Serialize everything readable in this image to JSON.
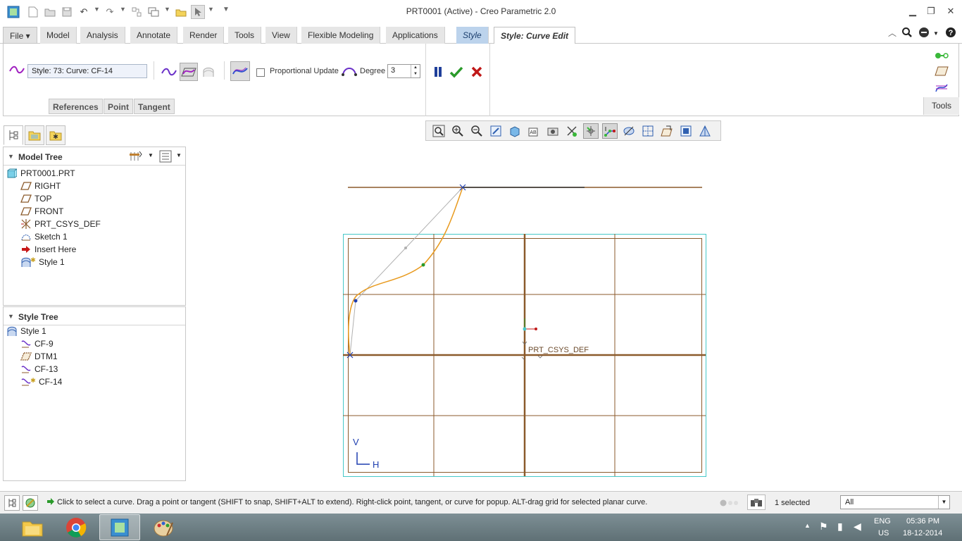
{
  "window": {
    "title": "PRT0001 (Active) - Creo Parametric 2.0"
  },
  "quick_access": {
    "icons": [
      "new-icon",
      "open-icon",
      "save-icon",
      "undo-icon",
      "redo-icon",
      "regenerate-icon",
      "windows-icon",
      "close-icon",
      "select-icon"
    ]
  },
  "tabs": [
    {
      "label": "File"
    },
    {
      "label": "Model"
    },
    {
      "label": "Analysis"
    },
    {
      "label": "Annotate"
    },
    {
      "label": "Render"
    },
    {
      "label": "Tools"
    },
    {
      "label": "View"
    },
    {
      "label": "Flexible Modeling"
    },
    {
      "label": "Applications"
    },
    {
      "label": "Style"
    },
    {
      "label": "Style: Curve Edit"
    }
  ],
  "ribbon": {
    "style_label": "Style: 73: Curve:   CF-14",
    "proportional_update_label": "Proportional Update",
    "proportional_update_checked": false,
    "degree_label": "Degree",
    "degree_value": "3",
    "subtabs": [
      "References",
      "Point",
      "Tangent"
    ],
    "tools_label": "Tools"
  },
  "model_tree": {
    "title": "Model Tree",
    "items": [
      {
        "label": "PRT0001.PRT",
        "icon": "part-icon"
      },
      {
        "label": "RIGHT",
        "icon": "datum-plane-icon"
      },
      {
        "label": "TOP",
        "icon": "datum-plane-icon"
      },
      {
        "label": "FRONT",
        "icon": "datum-plane-icon"
      },
      {
        "label": "PRT_CSYS_DEF",
        "icon": "csys-icon"
      },
      {
        "label": "Sketch 1",
        "icon": "sketch-icon"
      },
      {
        "label": "Insert Here",
        "icon": "insert-arrow-icon"
      },
      {
        "label": "Style 1",
        "icon": "style-feature-icon"
      }
    ]
  },
  "style_tree": {
    "title": "Style Tree",
    "items": [
      {
        "label": "Style 1",
        "icon": "style-feature-icon"
      },
      {
        "label": "CF-9",
        "icon": "style-curve-icon"
      },
      {
        "label": "DTM1",
        "icon": "datum-plane-icon"
      },
      {
        "label": "CF-13",
        "icon": "style-curve-icon"
      },
      {
        "label": "CF-14",
        "icon": "style-curve-active-icon"
      }
    ]
  },
  "viewport": {
    "csys_label": "PRT_CSYS_DEF",
    "axis_v": "V",
    "axis_h": "H",
    "colors": {
      "grid": "#8b5a2b",
      "boundary": "#46c8c8",
      "curve": "#e89a1e",
      "control_polygon": "#b0b0b0"
    }
  },
  "status": {
    "message": "Click to select a curve.  Drag a point or tangent (SHIFT to snap, SHIFT+ALT to extend). Right-click point, tangent, or curve for popup. ALT-drag grid for selected planar curve.",
    "selected": "1 selected",
    "filter": "All"
  },
  "taskbar": {
    "apps": [
      "file-explorer-icon",
      "chrome-icon",
      "creo-icon",
      "paint-icon"
    ],
    "lang_top": "ENG",
    "lang_bottom": "US",
    "time": "05:36 PM",
    "date": "18-12-2014"
  }
}
